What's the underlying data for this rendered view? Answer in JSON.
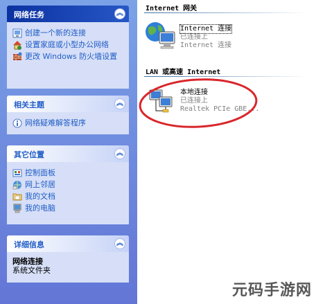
{
  "sidebar": {
    "network_tasks": {
      "title": "网络任务",
      "items": [
        {
          "label": "创建一个新的连接",
          "icon": "new-connection-icon"
        },
        {
          "label": "设置家庭或小型办公网络",
          "icon": "home-network-icon"
        },
        {
          "label": "更改 Windows 防火墙设置",
          "icon": "firewall-icon"
        }
      ]
    },
    "related_topics": {
      "title": "相关主题",
      "items": [
        {
          "label": "网络疑难解答程序",
          "icon": "info-icon"
        }
      ]
    },
    "other_places": {
      "title": "其它位置",
      "items": [
        {
          "label": "控制面板",
          "icon": "control-panel-icon"
        },
        {
          "label": "网上邻居",
          "icon": "network-places-icon"
        },
        {
          "label": "我的文档",
          "icon": "my-documents-icon"
        },
        {
          "label": "我的电脑",
          "icon": "my-computer-icon"
        }
      ]
    },
    "details": {
      "title": "详细信息",
      "name": "网络连接",
      "type": "系统文件夹"
    }
  },
  "main": {
    "internet_gateway": {
      "header": "Internet 网关",
      "connection": {
        "name": "Internet 连接",
        "status": "已连接上",
        "device": "Internet 连接"
      }
    },
    "lan": {
      "header": "LAN 或高速 Internet",
      "connection": {
        "name": "本地连接",
        "status": "已连接上",
        "device": "Realtek PCIe GBE..."
      }
    }
  },
  "watermark": "元码手游网",
  "colors": {
    "sidebar": "#6375d6",
    "panel": "#d6dff7",
    "link": "#215dc6",
    "annotation": "#d9262b"
  }
}
